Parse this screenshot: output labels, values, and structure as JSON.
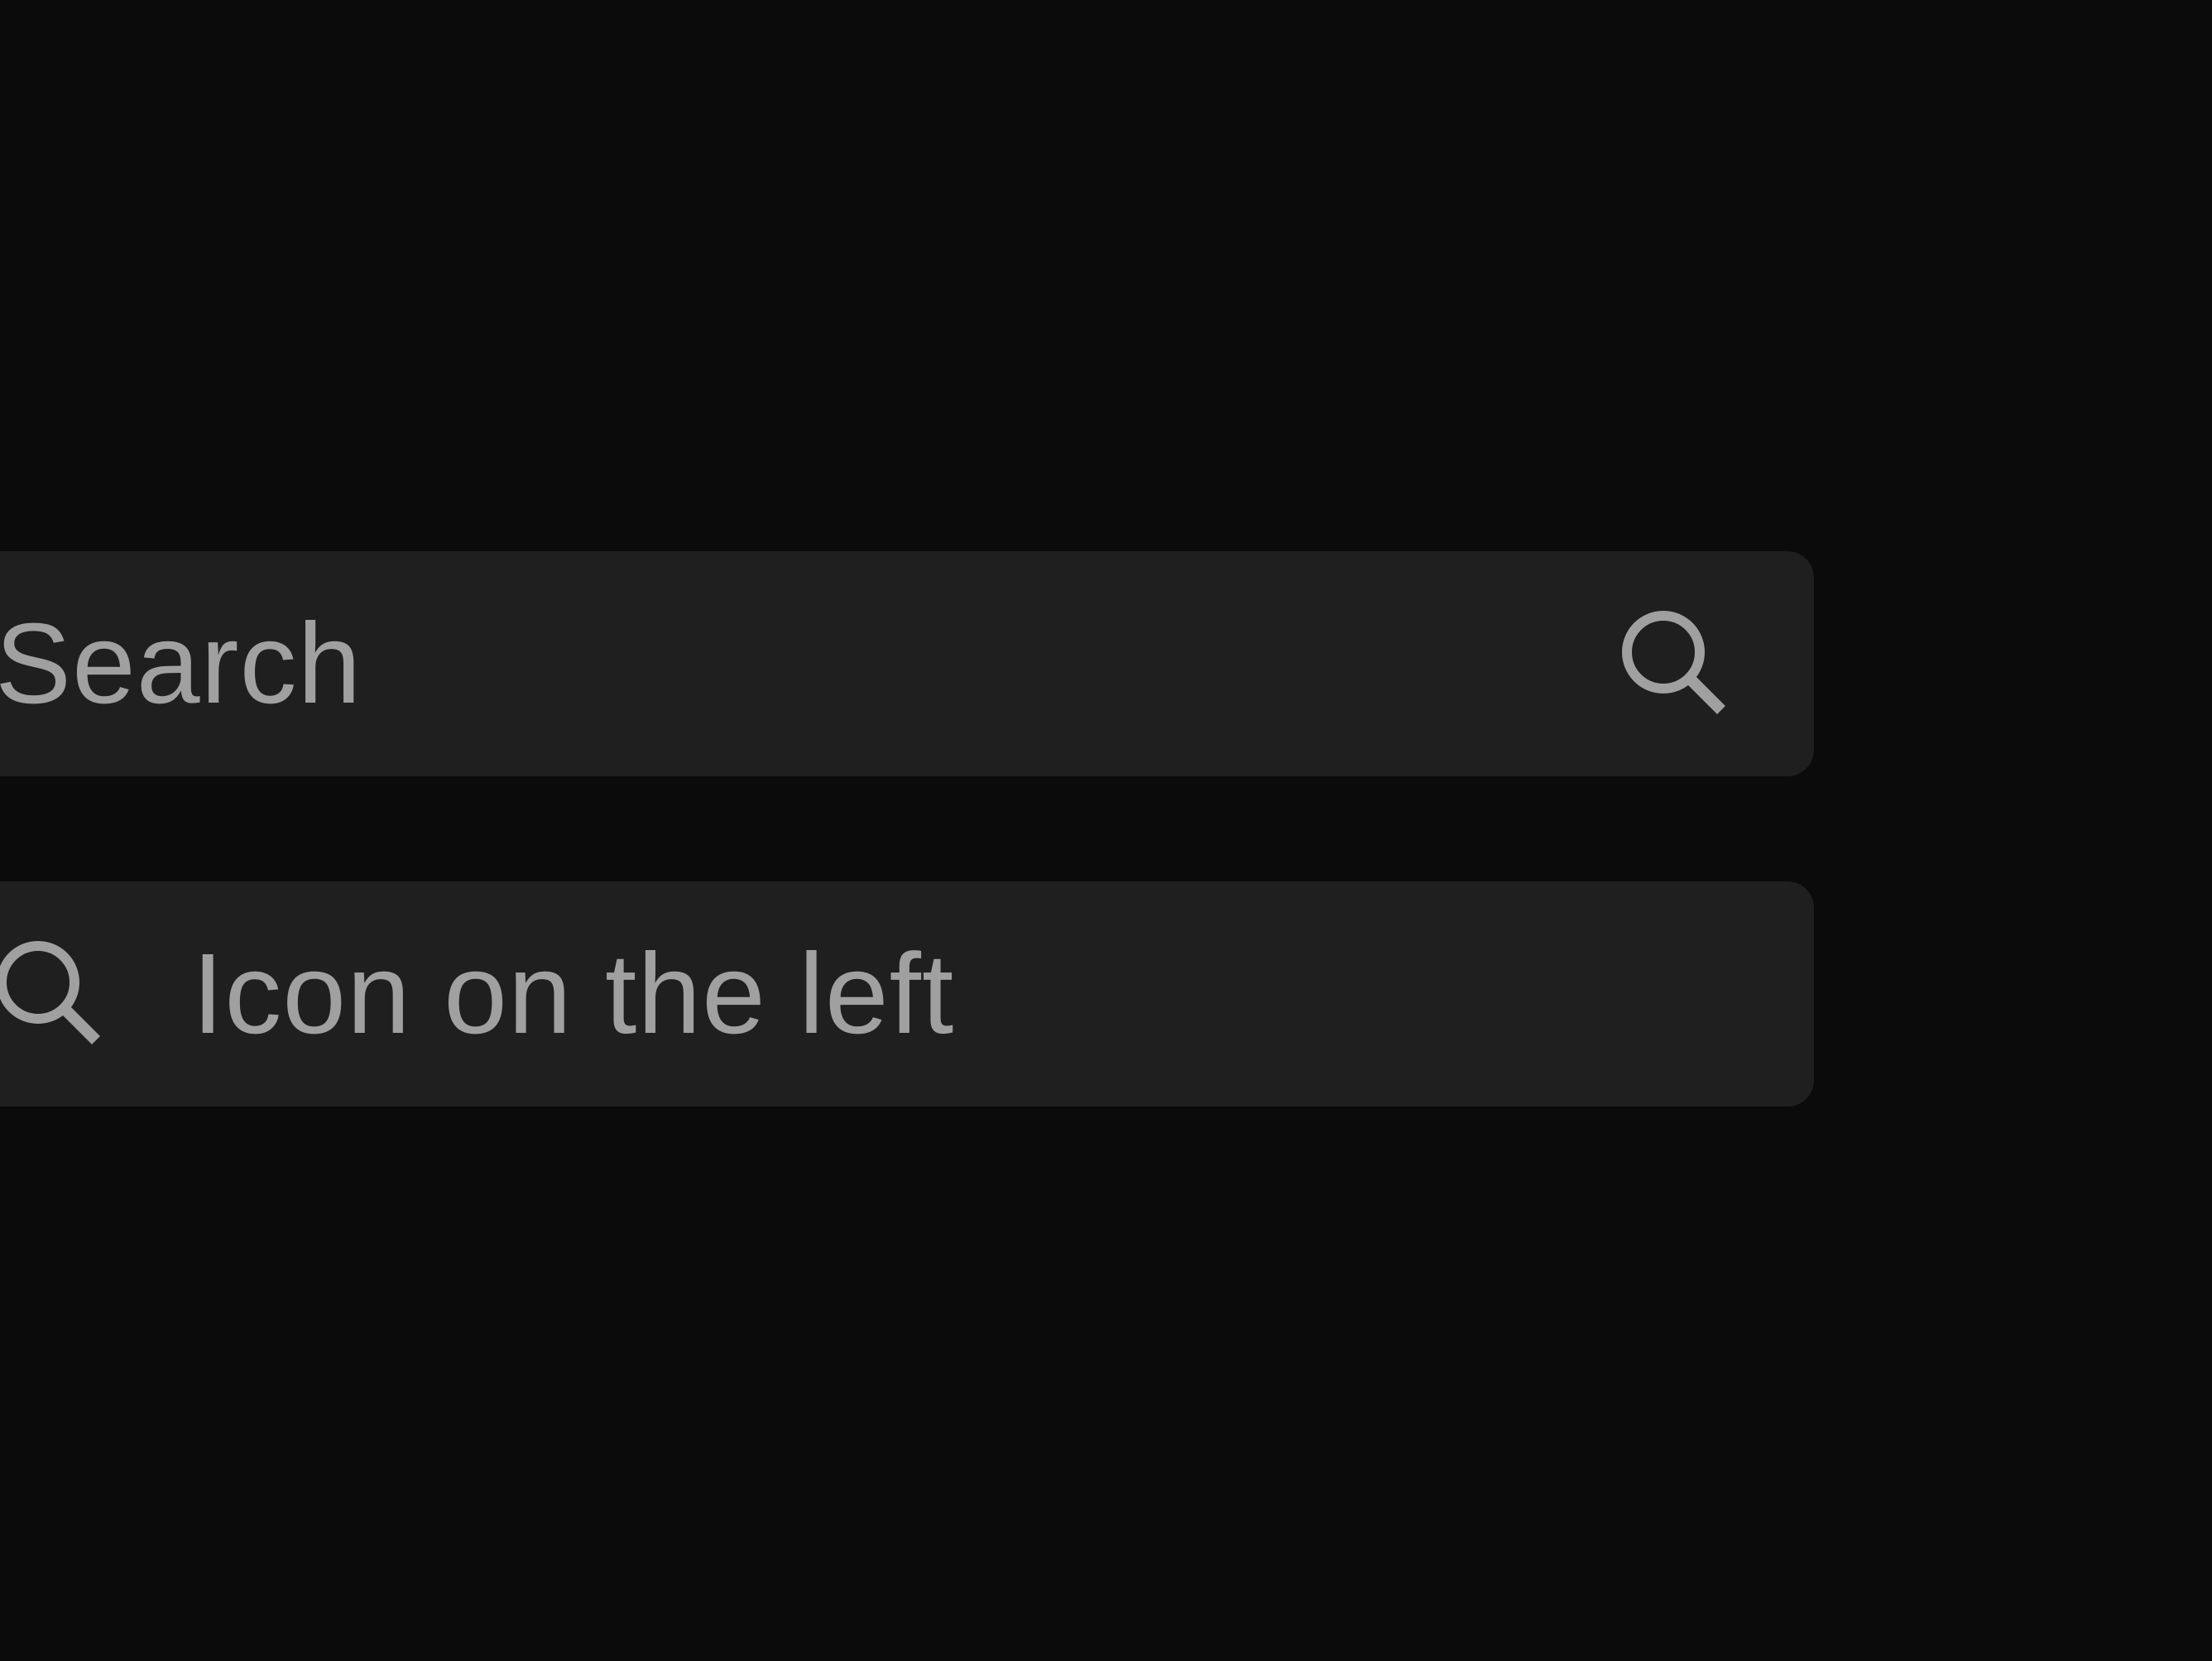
{
  "fields": {
    "icon_right": {
      "placeholder": "Search",
      "icon": "search-icon"
    },
    "icon_left": {
      "placeholder": "Icon on the left",
      "icon": "search-icon"
    }
  },
  "colors": {
    "background": "#0b0b0b",
    "field_background": "#1f1f1f",
    "text_and_icon": "#a0a0a0"
  }
}
